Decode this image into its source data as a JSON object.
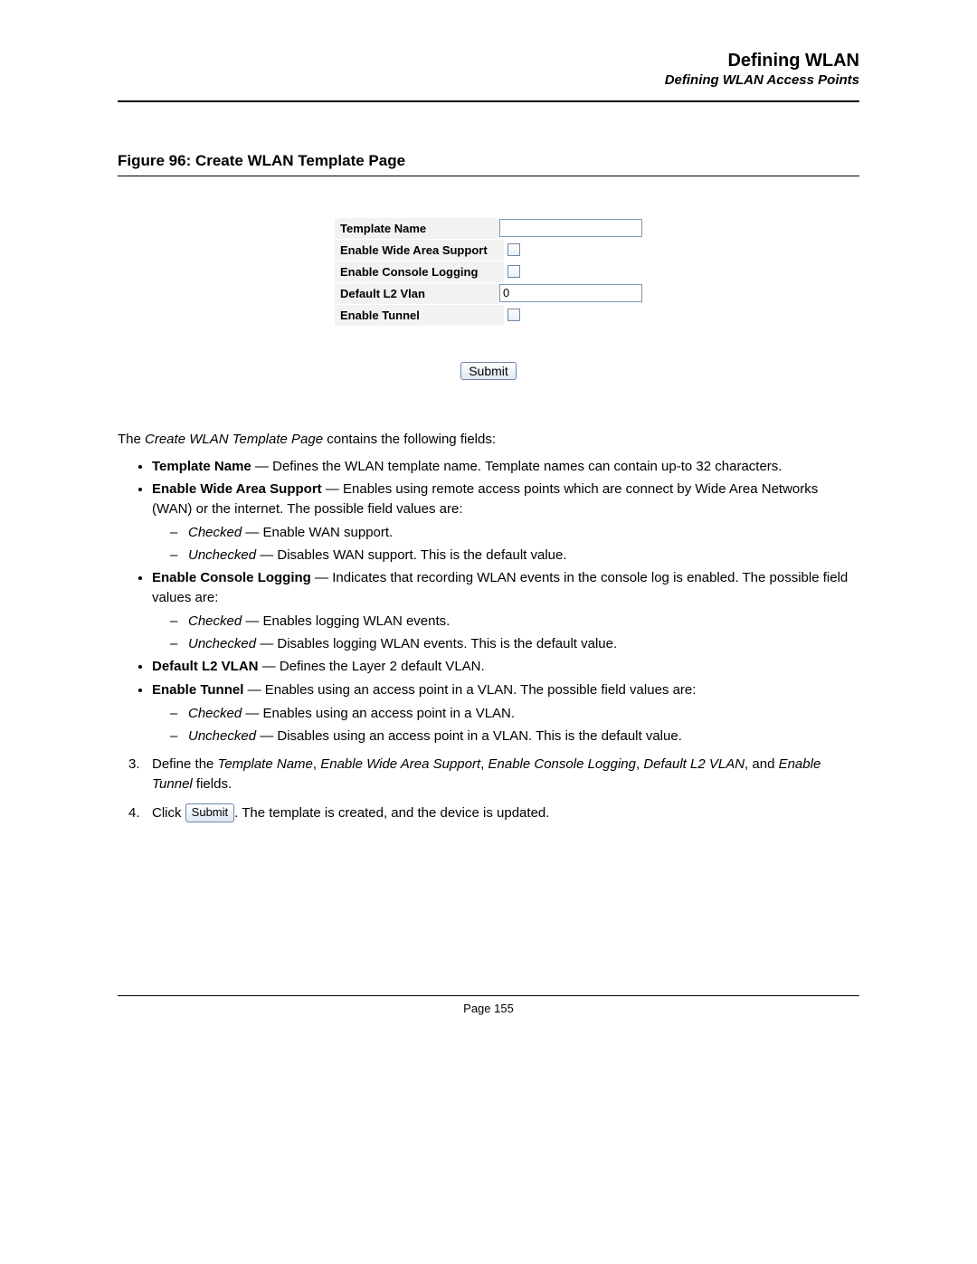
{
  "header": {
    "main": "Defining WLAN",
    "sub": "Defining WLAN Access Points"
  },
  "figure": {
    "caption": "Figure 96:  Create WLAN Template Page"
  },
  "form": {
    "rows": {
      "template_name": {
        "label": "Template Name",
        "value": ""
      },
      "enable_wan": {
        "label": "Enable Wide Area Support"
      },
      "enable_log": {
        "label": "Enable Console Logging"
      },
      "default_l2": {
        "label": "Default L2 Vlan",
        "value": "0"
      },
      "enable_tunnel": {
        "label": "Enable Tunnel"
      }
    },
    "submit": "Submit"
  },
  "intro": {
    "lead": "The ",
    "page_name": "Create WLAN Template Page",
    "rest": " contains the following fields:"
  },
  "fields": {
    "tn": {
      "name": "Template Name",
      "dash": " — ",
      "desc": "Defines the WLAN template name. Template names can contain up-to 32 characters."
    },
    "wan": {
      "name": "Enable Wide Area Support",
      "dash": " — ",
      "desc": "Enables using remote access points which are connect by Wide Area Networks (WAN) or the internet. The possible field values are:",
      "checked_lbl": "Checked",
      "checked_desc": " — Enable WAN support.",
      "unchecked_lbl": "Unchecked",
      "unchecked_desc": " — Disables WAN support. This is the default value."
    },
    "log": {
      "name": "Enable Console Logging",
      "dash": " — ",
      "desc": "Indicates that recording WLAN events in the console log is enabled. The possible field values are:",
      "checked_lbl": "Checked",
      "checked_desc": " — Enables logging WLAN events.",
      "unchecked_lbl": "Unchecked",
      "unchecked_desc": " — Disables logging WLAN events. This is the default value."
    },
    "l2": {
      "name": "Default L2 VLAN",
      "dash": " — ",
      "desc": "Defines the Layer 2 default VLAN."
    },
    "tunnel": {
      "name": "Enable Tunnel",
      "dash": " — ",
      "desc": "Enables using an access point in a VLAN. The possible field values are:",
      "checked_lbl": "Checked",
      "checked_desc": " — Enables using an access point in a VLAN.",
      "unchecked_lbl": "Unchecked",
      "unchecked_desc": " — Disables using an access point in a VLAN. This is the default value."
    }
  },
  "steps": {
    "s3": {
      "lead": "Define the ",
      "f1": "Template Name",
      "c1": ", ",
      "f2": "Enable Wide Area Support",
      "c2": ", ",
      "f3": "Enable Console Logging",
      "c3": ", ",
      "f4": "Default L2 VLAN",
      "c4": ", and ",
      "f5": "Enable Tunnel",
      "rest": " fields."
    },
    "s4": {
      "lead": "Click ",
      "btn": "Submit",
      "rest": ". The template is created, and the device is updated."
    }
  },
  "footer": {
    "page": "Page 155"
  }
}
